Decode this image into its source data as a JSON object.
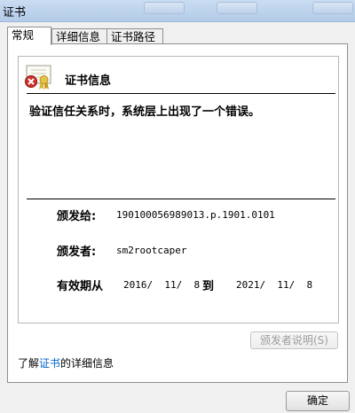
{
  "window": {
    "title": "证书"
  },
  "tabs": [
    {
      "label": "常规"
    },
    {
      "label": "详细信息"
    },
    {
      "label": "证书路径"
    }
  ],
  "cert": {
    "heading": "证书信息",
    "error": "验证信任关系时，系统层上出现了一个错误。",
    "issued_to_label": "颁发给:",
    "issued_to_value": "190100056989013.p.1901.0101",
    "issued_by_label": "颁发者:",
    "issued_by_value": "sm2rootcaper",
    "valid_from_label": "有效期从",
    "valid_from_value": "2016/  11/  8",
    "valid_to_label": "到",
    "valid_to_value": "2021/  11/  8"
  },
  "buttons": {
    "issuer_statement": "颁发者说明(S)",
    "ok": "确定"
  },
  "learn_more": {
    "prefix": "了解",
    "link": "证书",
    "suffix": "的详细信息"
  },
  "icons": {
    "certificate": "certificate-error-icon"
  }
}
